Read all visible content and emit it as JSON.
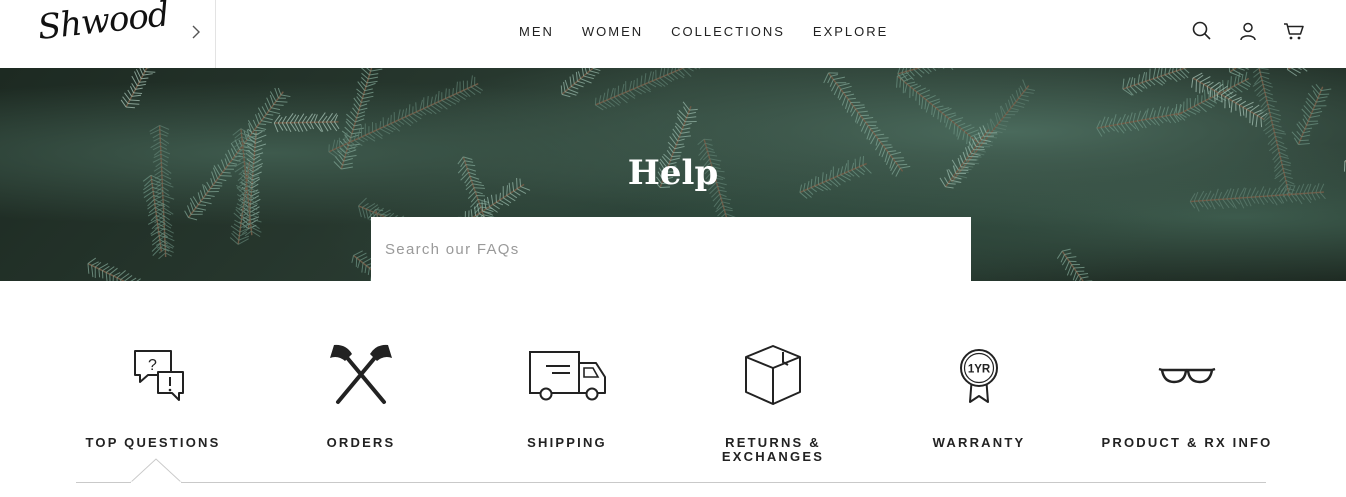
{
  "brand": {
    "logo_text": "Shwood"
  },
  "header": {
    "nav": [
      "MEN",
      "WOMEN",
      "COLLECTIONS",
      "EXPLORE"
    ],
    "icons": [
      "search-icon",
      "account-icon",
      "cart-icon"
    ]
  },
  "hero": {
    "title": "Help",
    "search_placeholder": "Search our FAQs"
  },
  "categories": [
    {
      "label": "TOP QUESTIONS",
      "icon": "question-chat-icon",
      "active": true
    },
    {
      "label": "ORDERS",
      "icon": "crossed-axes-icon",
      "active": false
    },
    {
      "label": "SHIPPING",
      "icon": "truck-icon",
      "active": false
    },
    {
      "label": "RETURNS & EXCHANGES",
      "icon": "box-icon",
      "active": false
    },
    {
      "label": "WARRANTY",
      "icon": "warranty-badge-icon",
      "badge_text": "1YR",
      "active": false
    },
    {
      "label": "PRODUCT & RX INFO",
      "icon": "glasses-icon",
      "active": false
    }
  ],
  "colors": {
    "text": "#222222",
    "rule": "#c9c9c9",
    "hero_green": "#2b3d33"
  }
}
